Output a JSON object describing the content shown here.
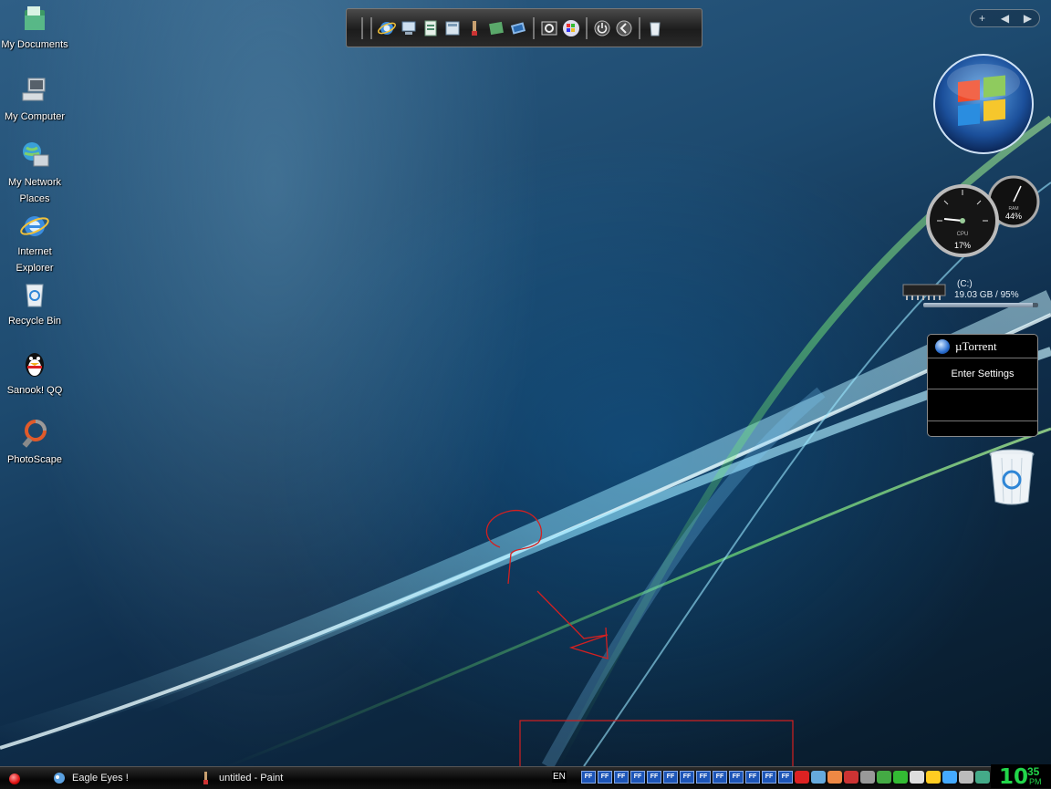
{
  "desktop_icons": [
    {
      "label": "My Documents",
      "icon": "folder-documents-icon"
    },
    {
      "label": "My Computer",
      "icon": "computer-icon"
    },
    {
      "label": "My Network Places",
      "icon": "network-globe-icon"
    },
    {
      "label": "Internet Explorer",
      "icon": "internet-explorer-icon"
    },
    {
      "label": "Recycle Bin",
      "icon": "recycle-bin-icon"
    },
    {
      "label": "Sanook! QQ",
      "icon": "qq-penguin-icon"
    },
    {
      "label": "PhotoScape",
      "icon": "photoscape-icon"
    }
  ],
  "sidebar_toolbar": {
    "add": "+",
    "prev": "◀",
    "next": "▶"
  },
  "gadgets": {
    "cpu_percent": "17%",
    "ram_percent": "44%",
    "drive": {
      "name": "(C:)",
      "size": "19.03 GB / 95%",
      "used_fraction": 0.95
    },
    "utorrent": {
      "title": "µTorrent",
      "settings": "Enter Settings"
    }
  },
  "taskbar": {
    "tasks": [
      {
        "label": "Eagle Eyes !",
        "icon": "eagle-eyes-icon"
      },
      {
        "label": "untitled - Paint",
        "icon": "paint-icon"
      }
    ],
    "language": "EN",
    "tray_ff_label": "FF",
    "tray_ff_count": 13,
    "clock": {
      "hour": "10",
      "minute": "35",
      "ampm": "PM"
    }
  },
  "colors": {
    "annotation": "#d42020",
    "clock": "#22d64a"
  }
}
